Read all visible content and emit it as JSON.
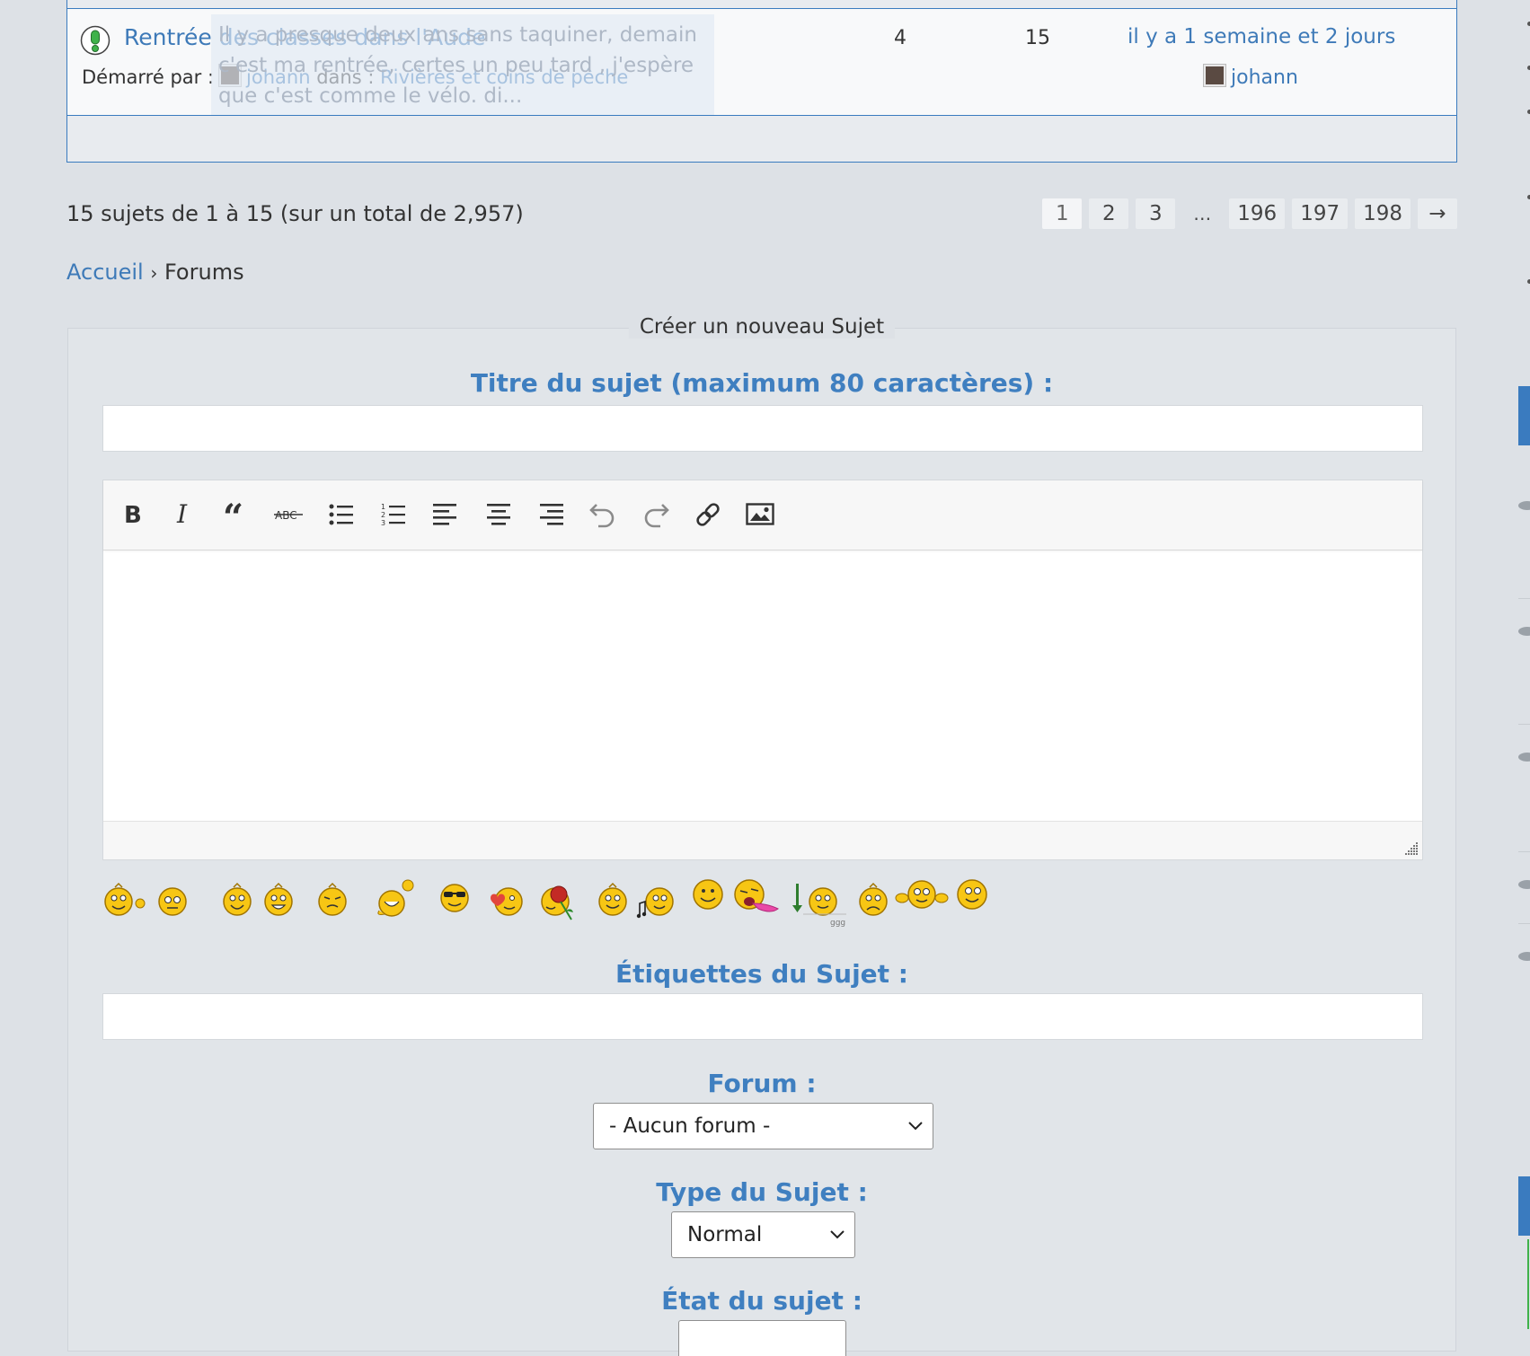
{
  "topic": {
    "title": "Rentrée des classes dans l'Aude",
    "started_by_label": "Démarré par :",
    "author": "johann",
    "in_label": "dans :",
    "forum": "Rivières et coins de pêche",
    "replies": "4",
    "posts": "15",
    "freshness": "il y a 1 semaine et 2 jours",
    "last_poster": "johann",
    "preview_text": "Il y a presque deux ans sans taquiner, demain c'est ma rentrée, certes un peu tard  , j'espère que c'est comme le vélo.  di..."
  },
  "pagination": {
    "count_text": "15 sujets de 1 à 15 (sur un total de 2,957)",
    "pages": [
      "1",
      "2",
      "3",
      "…",
      "196",
      "197",
      "198",
      "→"
    ]
  },
  "breadcrumb": {
    "home": "Accueil",
    "separator": "›",
    "current": "Forums"
  },
  "form": {
    "legend": "Créer un nouveau Sujet",
    "title_label": "Titre du sujet (maximum 80 caractères) :",
    "tags_label": "Étiquettes du Sujet :",
    "forum_label": "Forum :",
    "forum_value": "- Aucun forum -",
    "type_label": "Type du Sujet :",
    "type_value": "Normal",
    "status_label": "État du sujet :"
  },
  "toolbar_icons": [
    "bold-icon",
    "italic-icon",
    "quote-icon",
    "strikethrough-icon",
    "bullet-list-icon",
    "numbered-list-icon",
    "align-left-icon",
    "align-center-icon",
    "align-right-icon",
    "undo-icon",
    "redo-icon",
    "link-icon",
    "image-icon"
  ],
  "colors": {
    "accent": "#3f7fc0",
    "link": "#3e7ab8",
    "background": "#dde1e6",
    "border": "#3a7bbf"
  }
}
